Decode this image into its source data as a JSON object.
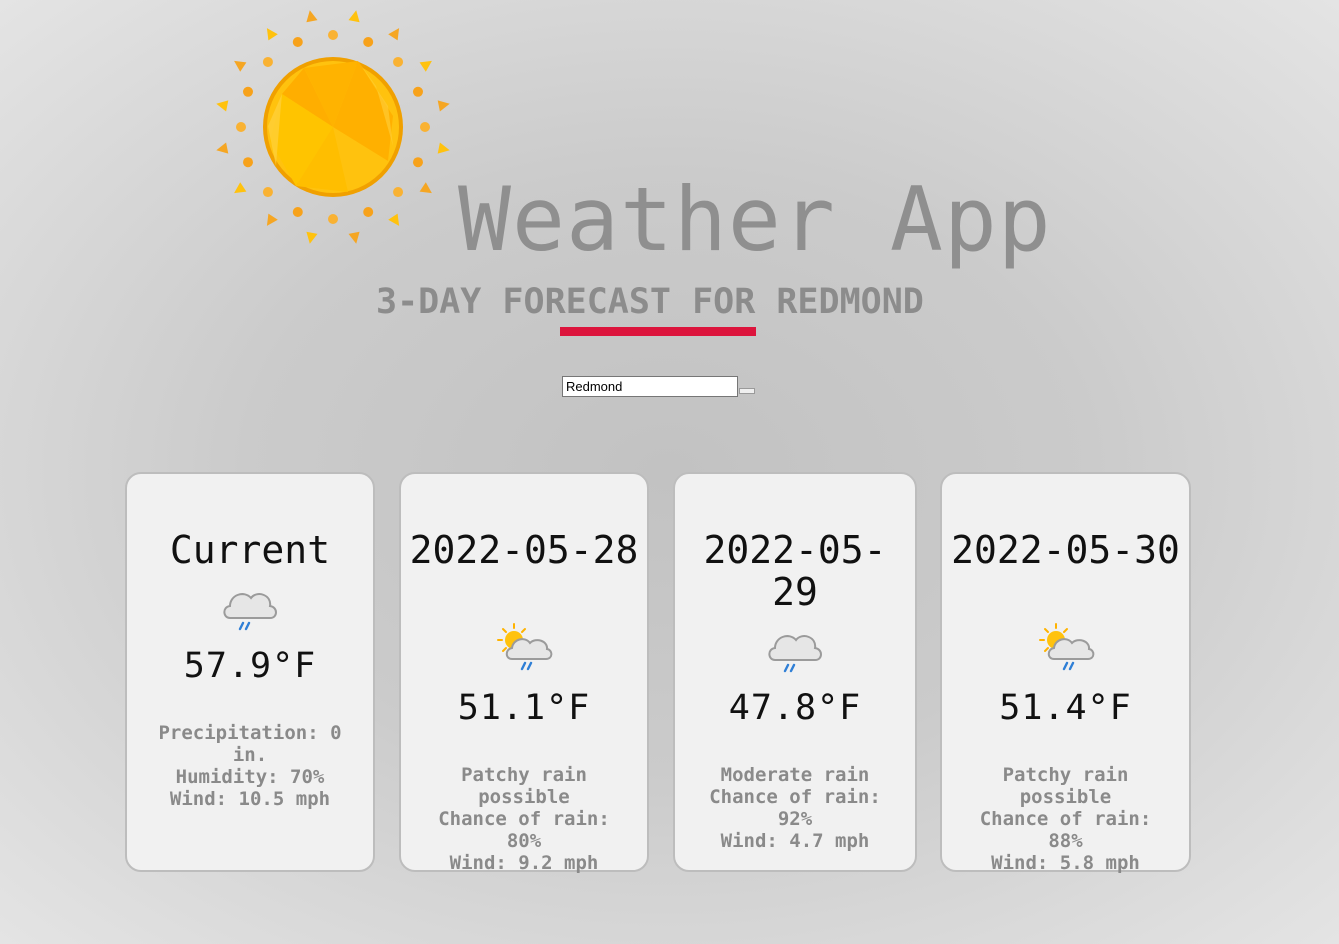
{
  "header": {
    "title": "Weather App",
    "subtitle": "3-DAY FORECAST FOR REDMOND",
    "accent_color": "#dc143c"
  },
  "search": {
    "value": "Redmond",
    "button_label": ""
  },
  "cards": [
    {
      "title": "Current",
      "icon": "light-rain-cloud-icon",
      "temp": "57.9°F",
      "details": [
        "Precipitation: 0 in.",
        "Humidity: 70%",
        "Wind: 10.5 mph"
      ]
    },
    {
      "title": "2022-05-28",
      "icon": "patchy-rain-sun-cloud-icon",
      "temp": "51.1°F",
      "details": [
        "Patchy rain possible",
        "Chance of rain: 80%",
        "Wind: 9.2 mph"
      ]
    },
    {
      "title": "2022-05-29",
      "icon": "moderate-rain-cloud-icon",
      "temp": "47.8°F",
      "details": [
        "Moderate rain",
        "Chance of rain: 92%",
        "Wind: 4.7 mph"
      ]
    },
    {
      "title": "2022-05-30",
      "icon": "patchy-rain-sun-cloud-icon",
      "temp": "51.4°F",
      "details": [
        "Patchy rain possible",
        "Chance of rain: 88%",
        "Wind: 5.8 mph"
      ]
    }
  ]
}
